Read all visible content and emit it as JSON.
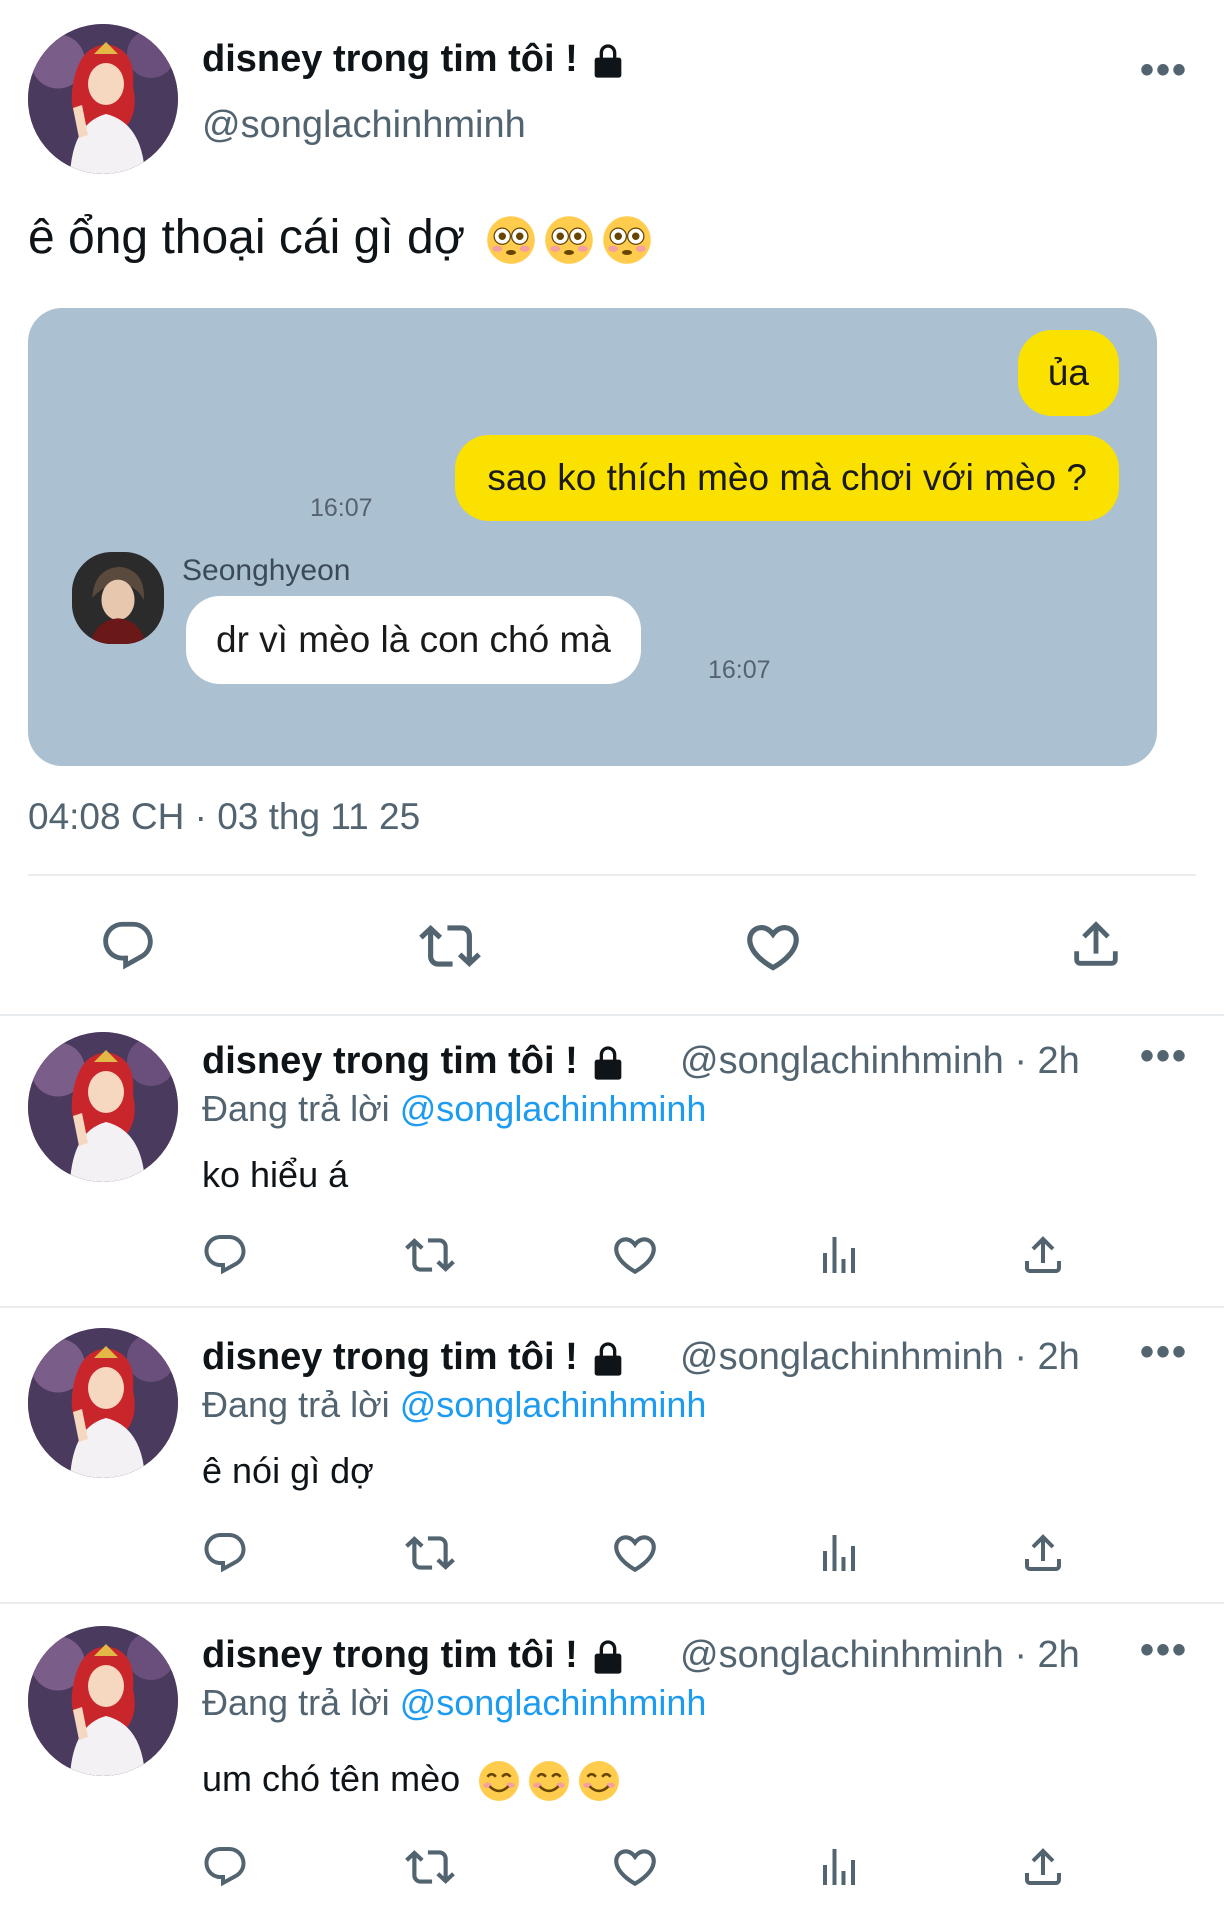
{
  "main_tweet": {
    "display_name": "disney trong tim tôi !",
    "handle": "@songlachinhminh",
    "text": "ê ổng thoại cái gì dợ",
    "emoji": "flushed-face",
    "timestamp": "04:08 CH · 03 thg 11 25"
  },
  "chat": {
    "messages": [
      {
        "side": "right",
        "text": "ủa"
      },
      {
        "side": "right",
        "text": "sao ko thích mèo mà chơi với mèo ?",
        "time": "16:07"
      },
      {
        "side": "left",
        "sender": "Seonghyeon",
        "text": "dr vì mèo là con chó mà",
        "time": "16:07"
      }
    ]
  },
  "replies": [
    {
      "display_name": "disney trong tim tôi !",
      "handle_time": "@songlachinhminh · 2h",
      "replying_label": "Đang trả lời",
      "replying_to": "@songlachinhminh",
      "text": "ko hiểu á"
    },
    {
      "display_name": "disney trong tim tôi !",
      "handle_time": "@songlachinhminh · 2h",
      "replying_label": "Đang trả lời",
      "replying_to": "@songlachinhminh",
      "text": "ê nói gì dợ"
    },
    {
      "display_name": "disney trong tim tôi !",
      "handle_time": "@songlachinhminh · 2h",
      "replying_label": "Đang trả lời",
      "replying_to": "@songlachinhminh",
      "text": "um chó tên mèo",
      "emoji": "smiling-face"
    }
  ],
  "more_label": "•••",
  "colors": {
    "chat_bg": "#abc1d1",
    "bubble_yellow": "#fae100",
    "link_blue": "#1d9bf0",
    "muted_text": "#536471"
  }
}
